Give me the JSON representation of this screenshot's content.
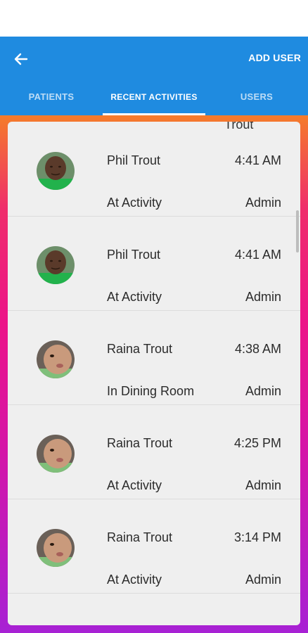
{
  "appbar": {
    "add_user_label": "ADD USER",
    "tabs": [
      {
        "label": "PATIENTS",
        "active": false
      },
      {
        "label": "RECENT ACTIVITIES",
        "active": true
      },
      {
        "label": "USERS",
        "active": false
      }
    ]
  },
  "list": {
    "peek_text": "Trout",
    "items": [
      {
        "name": "Phil Trout",
        "time": "4:41 AM",
        "activity": "At Activity",
        "by": "Admin",
        "avatar": "man-photo"
      },
      {
        "name": "Phil Trout",
        "time": "4:41 AM",
        "activity": "At Activity",
        "by": "Admin",
        "avatar": "man-photo"
      },
      {
        "name": "Raina Trout",
        "time": "4:38 AM",
        "activity": "In Dining Room",
        "by": "Admin",
        "avatar": "baby-photo"
      },
      {
        "name": "Raina Trout",
        "time": "4:25 PM",
        "activity": "At Activity",
        "by": "Admin",
        "avatar": "baby-photo"
      },
      {
        "name": "Raina Trout",
        "time": "3:14 PM",
        "activity": "At Activity",
        "by": "Admin",
        "avatar": "baby-photo"
      }
    ]
  },
  "colors": {
    "appbar": "#1f8be0",
    "gradient_top": "#f57c2a",
    "gradient_mid": "#ec1488",
    "gradient_bottom": "#a721d4",
    "card": "#efefef"
  }
}
